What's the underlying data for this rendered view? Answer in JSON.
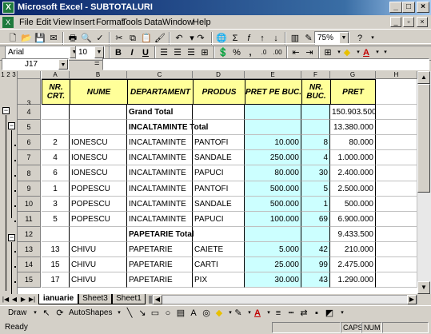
{
  "window": {
    "title": "Microsoft Excel - SUBTOTALURI"
  },
  "menu": [
    "File",
    "Edit",
    "View",
    "Insert",
    "Format",
    "Tools",
    "Data",
    "Window",
    "Help"
  ],
  "toolbar": {
    "zoom": "75%",
    "font": "Arial",
    "font_size": "10"
  },
  "formula_bar": {
    "name_box": "J17",
    "equals": "="
  },
  "outline_levels": [
    "1",
    "2",
    "3"
  ],
  "columns": [
    "A",
    "B",
    "C",
    "D",
    "E",
    "F",
    "G",
    "H"
  ],
  "headers": {
    "nr_crt": "NR. CRT.",
    "nume": "NUME",
    "departament": "DEPARTAMENT",
    "produs": "PRODUS",
    "pret_pe_buc": "PRET PE BUC.",
    "nr_buc": "NR. BUC.",
    "pret": "PRET"
  },
  "rows": [
    {
      "num": "4",
      "nr": "",
      "nume": "",
      "dep": "Grand Total",
      "produs": "",
      "pret_buc": "",
      "nr_buc": "",
      "pret": "150.903.500",
      "total": true
    },
    {
      "num": "5",
      "nr": "",
      "nume": "",
      "dep": "INCALTAMINTE Total",
      "produs": "",
      "pret_buc": "",
      "nr_buc": "",
      "pret": "13.380.000",
      "total": true
    },
    {
      "num": "6",
      "nr": "2",
      "nume": "IONESCU",
      "dep": "INCALTAMINTE",
      "produs": "PANTOFI",
      "pret_buc": "10.000",
      "nr_buc": "8",
      "pret": "80.000"
    },
    {
      "num": "7",
      "nr": "4",
      "nume": "IONESCU",
      "dep": "INCALTAMINTE",
      "produs": "SANDALE",
      "pret_buc": "250.000",
      "nr_buc": "4",
      "pret": "1.000.000"
    },
    {
      "num": "8",
      "nr": "6",
      "nume": "IONESCU",
      "dep": "INCALTAMINTE",
      "produs": "PAPUCI",
      "pret_buc": "80.000",
      "nr_buc": "30",
      "pret": "2.400.000"
    },
    {
      "num": "9",
      "nr": "1",
      "nume": "POPESCU",
      "dep": "INCALTAMINTE",
      "produs": "PANTOFI",
      "pret_buc": "500.000",
      "nr_buc": "5",
      "pret": "2.500.000"
    },
    {
      "num": "10",
      "nr": "3",
      "nume": "POPESCU",
      "dep": "INCALTAMINTE",
      "produs": "SANDALE",
      "pret_buc": "500.000",
      "nr_buc": "1",
      "pret": "500.000"
    },
    {
      "num": "11",
      "nr": "5",
      "nume": "POPESCU",
      "dep": "INCALTAMINTE",
      "produs": "PAPUCI",
      "pret_buc": "100.000",
      "nr_buc": "69",
      "pret": "6.900.000"
    },
    {
      "num": "12",
      "nr": "",
      "nume": "",
      "dep": "PAPETARIE Total",
      "produs": "",
      "pret_buc": "",
      "nr_buc": "",
      "pret": "9.433.500",
      "total": true
    },
    {
      "num": "13",
      "nr": "13",
      "nume": "CHIVU",
      "dep": "PAPETARIE",
      "produs": "CAIETE",
      "pret_buc": "5.000",
      "nr_buc": "42",
      "pret": "210.000"
    },
    {
      "num": "14",
      "nr": "15",
      "nume": "CHIVU",
      "dep": "PAPETARIE",
      "produs": "CARTI",
      "pret_buc": "25.000",
      "nr_buc": "99",
      "pret": "2.475.000"
    },
    {
      "num": "15",
      "nr": "17",
      "nume": "CHIVU",
      "dep": "PAPETARIE",
      "produs": "PIX",
      "pret_buc": "30.000",
      "nr_buc": "43",
      "pret": "1.290.000"
    }
  ],
  "header_row_num": "3",
  "tabs": [
    "ianuarie",
    "Sheet3",
    "Sheet1"
  ],
  "draw": {
    "draw_label": "Draw",
    "autoshapes_label": "AutoShapes"
  },
  "status": {
    "ready": "Ready",
    "caps": "CAPS",
    "num": "NUM"
  },
  "colors": {
    "header_fill": "#ffff99",
    "price_fill": "#ccffff",
    "title_bar": "#0a246a"
  }
}
